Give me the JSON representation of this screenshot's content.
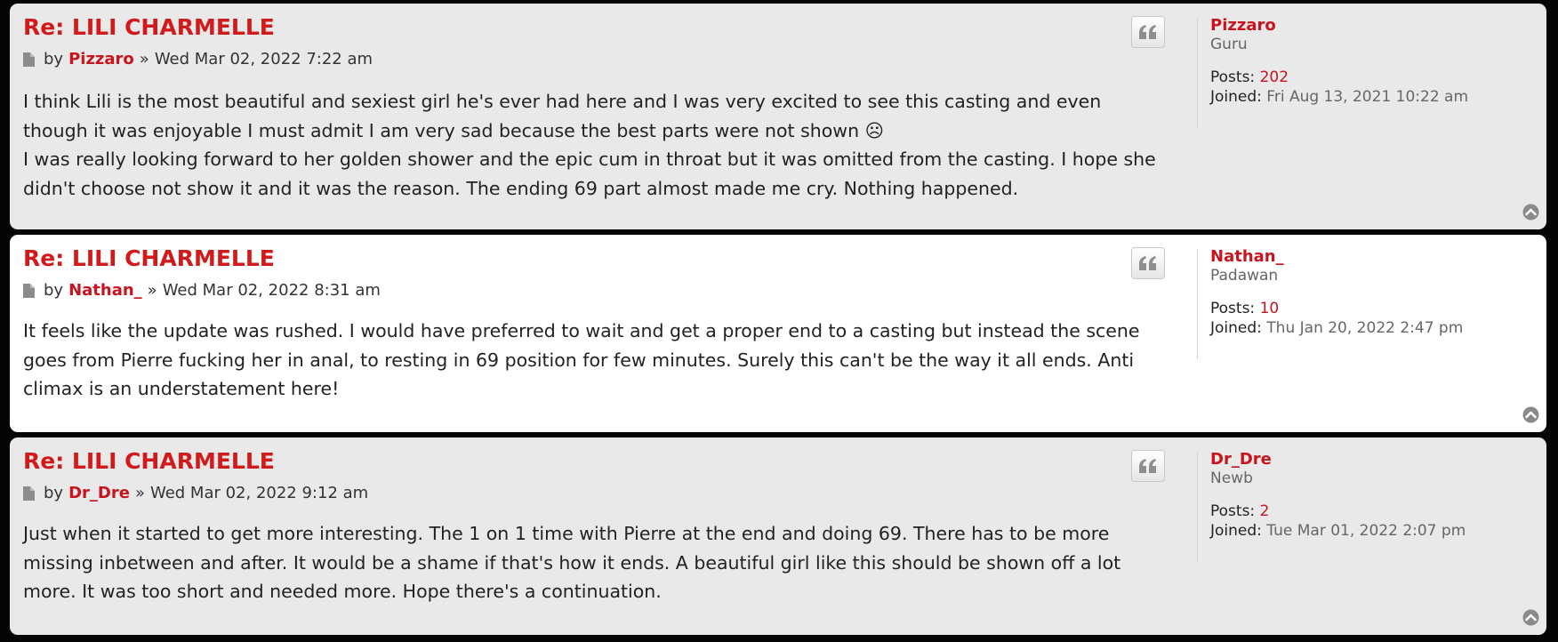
{
  "posts": [
    {
      "title": "Re: LILI CHARMELLE",
      "by_label": "by",
      "author": "Pizzaro",
      "separator": "»",
      "date": "Wed Mar 02, 2022 7:22 am",
      "paragraphs": [
        "I think Lili is the most beautiful and sexiest girl he's ever had here and I was very excited to see this casting and even though it was enjoyable I must admit I am very sad because the best parts were not shown ☹",
        "I was really looking forward to her golden shower and the epic cum in throat but it was omitted from the casting. I hope she didn't choose not show it and it was the reason. The ending 69 part almost made me cry. Nothing happened."
      ],
      "profile": {
        "name": "Pizzaro",
        "rank": "Guru",
        "posts_label": "Posts:",
        "posts_value": "202",
        "joined_label": "Joined:",
        "joined_value": "Fri Aug 13, 2021 10:22 am"
      }
    },
    {
      "title": "Re: LILI CHARMELLE",
      "by_label": "by",
      "author": "Nathan_",
      "separator": "»",
      "date": "Wed Mar 02, 2022 8:31 am",
      "paragraphs": [
        "It feels like the update was rushed. I would have preferred to wait and get a proper end to a casting but instead the scene goes from Pierre fucking her in anal, to resting in 69 position for few minutes. Surely this can't be the way it all ends. Anti climax is an understatement here!"
      ],
      "profile": {
        "name": "Nathan_",
        "rank": "Padawan",
        "posts_label": "Posts:",
        "posts_value": "10",
        "joined_label": "Joined:",
        "joined_value": "Thu Jan 20, 2022 2:47 pm"
      }
    },
    {
      "title": "Re: LILI CHARMELLE",
      "by_label": "by",
      "author": "Dr_Dre",
      "separator": "»",
      "date": "Wed Mar 02, 2022 9:12 am",
      "paragraphs": [
        "Just when it started to get more interesting. The 1 on 1 time with Pierre at the end and doing 69. There has to be more missing inbetween and after. It would be a shame if that's how it ends. A beautiful girl like this should be shown off a lot more. It was too short and needed more. Hope there's a continuation."
      ],
      "profile": {
        "name": "Dr_Dre",
        "rank": "Newb",
        "posts_label": "Posts:",
        "posts_value": "2",
        "joined_label": "Joined:",
        "joined_value": "Tue Mar 01, 2022 2:07 pm"
      }
    }
  ],
  "icons": {
    "post": "document-icon",
    "quote": "quote-icon",
    "top": "back-to-top-icon"
  },
  "colors": {
    "link_red": "#c8141e",
    "title_red": "#d21a1a",
    "post_bg_alt": "#e9e9e9",
    "post_bg": "#ffffff",
    "page_bg": "#050505"
  }
}
